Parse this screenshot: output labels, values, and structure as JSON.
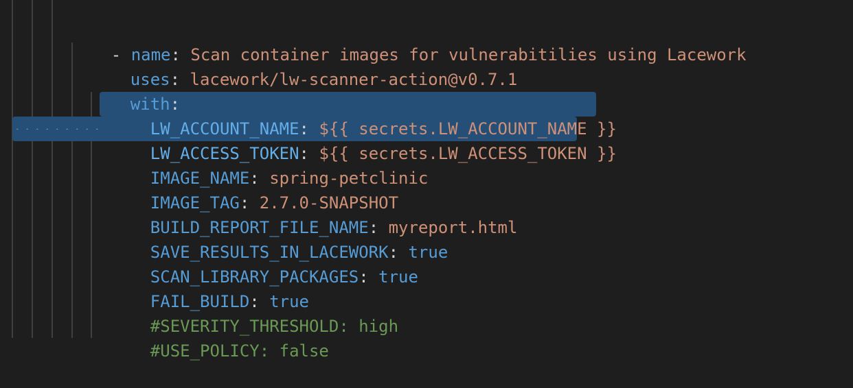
{
  "editor": {
    "lines": [
      {
        "dash": "- ",
        "key": "name",
        "colon": ": ",
        "value": "Scan container images for vulnerabitilies using Lacework",
        "vtype": "str"
      },
      {
        "key": "uses",
        "colon": ": ",
        "value": "lacework/lw-scanner-action@v0.7.1",
        "vtype": "str"
      },
      {
        "key": "with",
        "colon": ":"
      },
      {
        "key": "LW_ACCOUNT_NAME",
        "colon": ": ",
        "value": "${{ secrets.LW_ACCOUNT_NAME }}",
        "vtype": "str"
      },
      {
        "key": "LW_ACCESS_TOKEN",
        "colon": ": ",
        "value": "${{ secrets.LW_ACCESS_TOKEN }}",
        "vtype": "str"
      },
      {
        "key": "IMAGE_NAME",
        "colon": ": ",
        "value": "spring-petclinic",
        "vtype": "str"
      },
      {
        "key": "IMAGE_TAG",
        "colon": ": ",
        "value": "2.7.0-SNAPSHOT",
        "vtype": "str"
      },
      {
        "key": "BUILD_REPORT_FILE_NAME",
        "colon": ": ",
        "value": "myreport.html",
        "vtype": "str"
      },
      {
        "key": "SAVE_RESULTS_IN_LACEWORK",
        "colon": ": ",
        "value": "true",
        "vtype": "bool"
      },
      {
        "key": "SCAN_LIBRARY_PACKAGES",
        "colon": ": ",
        "value": "true",
        "vtype": "bool"
      },
      {
        "key": "FAIL_BUILD",
        "colon": ": ",
        "value": "true",
        "vtype": "bool"
      },
      {
        "comment": "#SEVERITY_THRESHOLD: high"
      },
      {
        "comment": "#USE_POLICY: false"
      }
    ]
  },
  "colors": {
    "background": "#1e1e1e",
    "key": "#569cd6",
    "string": "#ce9178",
    "boolean": "#569cd6",
    "comment": "#6a9955",
    "selection": "#264f78"
  }
}
